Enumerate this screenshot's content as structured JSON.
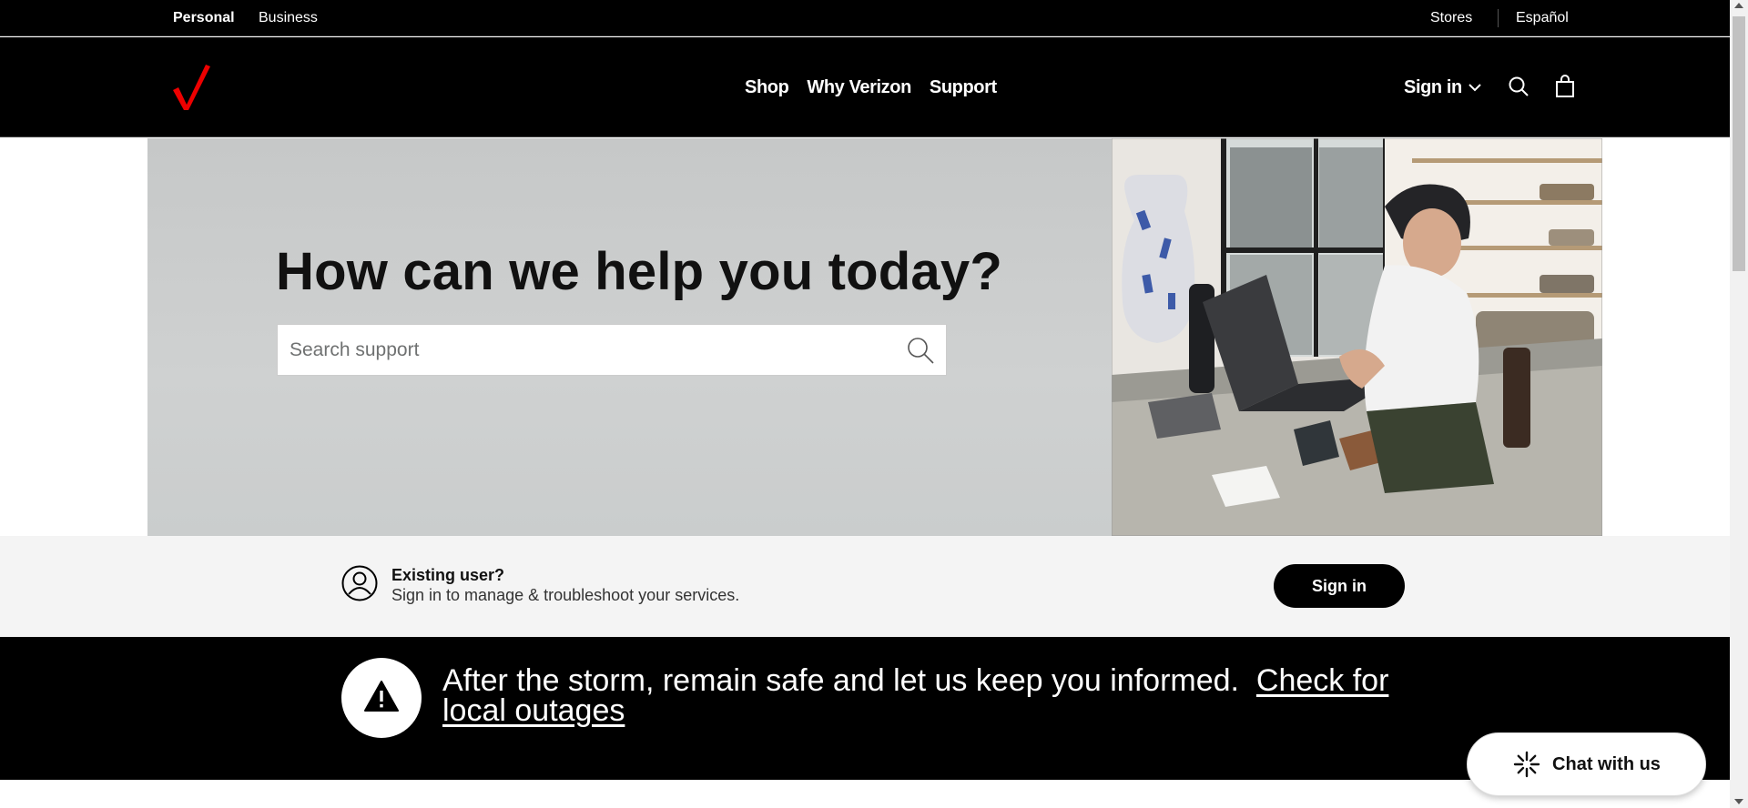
{
  "utility_bar": {
    "personal": "Personal",
    "business": "Business",
    "stores": "Stores",
    "espanol": "Español"
  },
  "nav": {
    "links": [
      "Shop",
      "Why Verizon",
      "Support"
    ],
    "sign_in": "Sign in",
    "icons": {
      "search": "search-icon",
      "cart": "shopping-bag-icon",
      "chevron": "chevron-down-icon"
    }
  },
  "hero": {
    "title": "How can we help you today?",
    "search_placeholder": "Search support",
    "search_value": ""
  },
  "existing_user": {
    "title": "Existing user?",
    "subtitle": "Sign in to manage & troubleshoot your services.",
    "button": "Sign in"
  },
  "alert": {
    "message": "After the storm, remain safe and let us keep you informed.",
    "link": "Check for local outages"
  },
  "chat": {
    "label": "Chat with us"
  },
  "colors": {
    "brand_red": "#ee0000",
    "black": "#000000",
    "hero_gray": "#c8caca",
    "band_gray": "#f4f4f4"
  }
}
